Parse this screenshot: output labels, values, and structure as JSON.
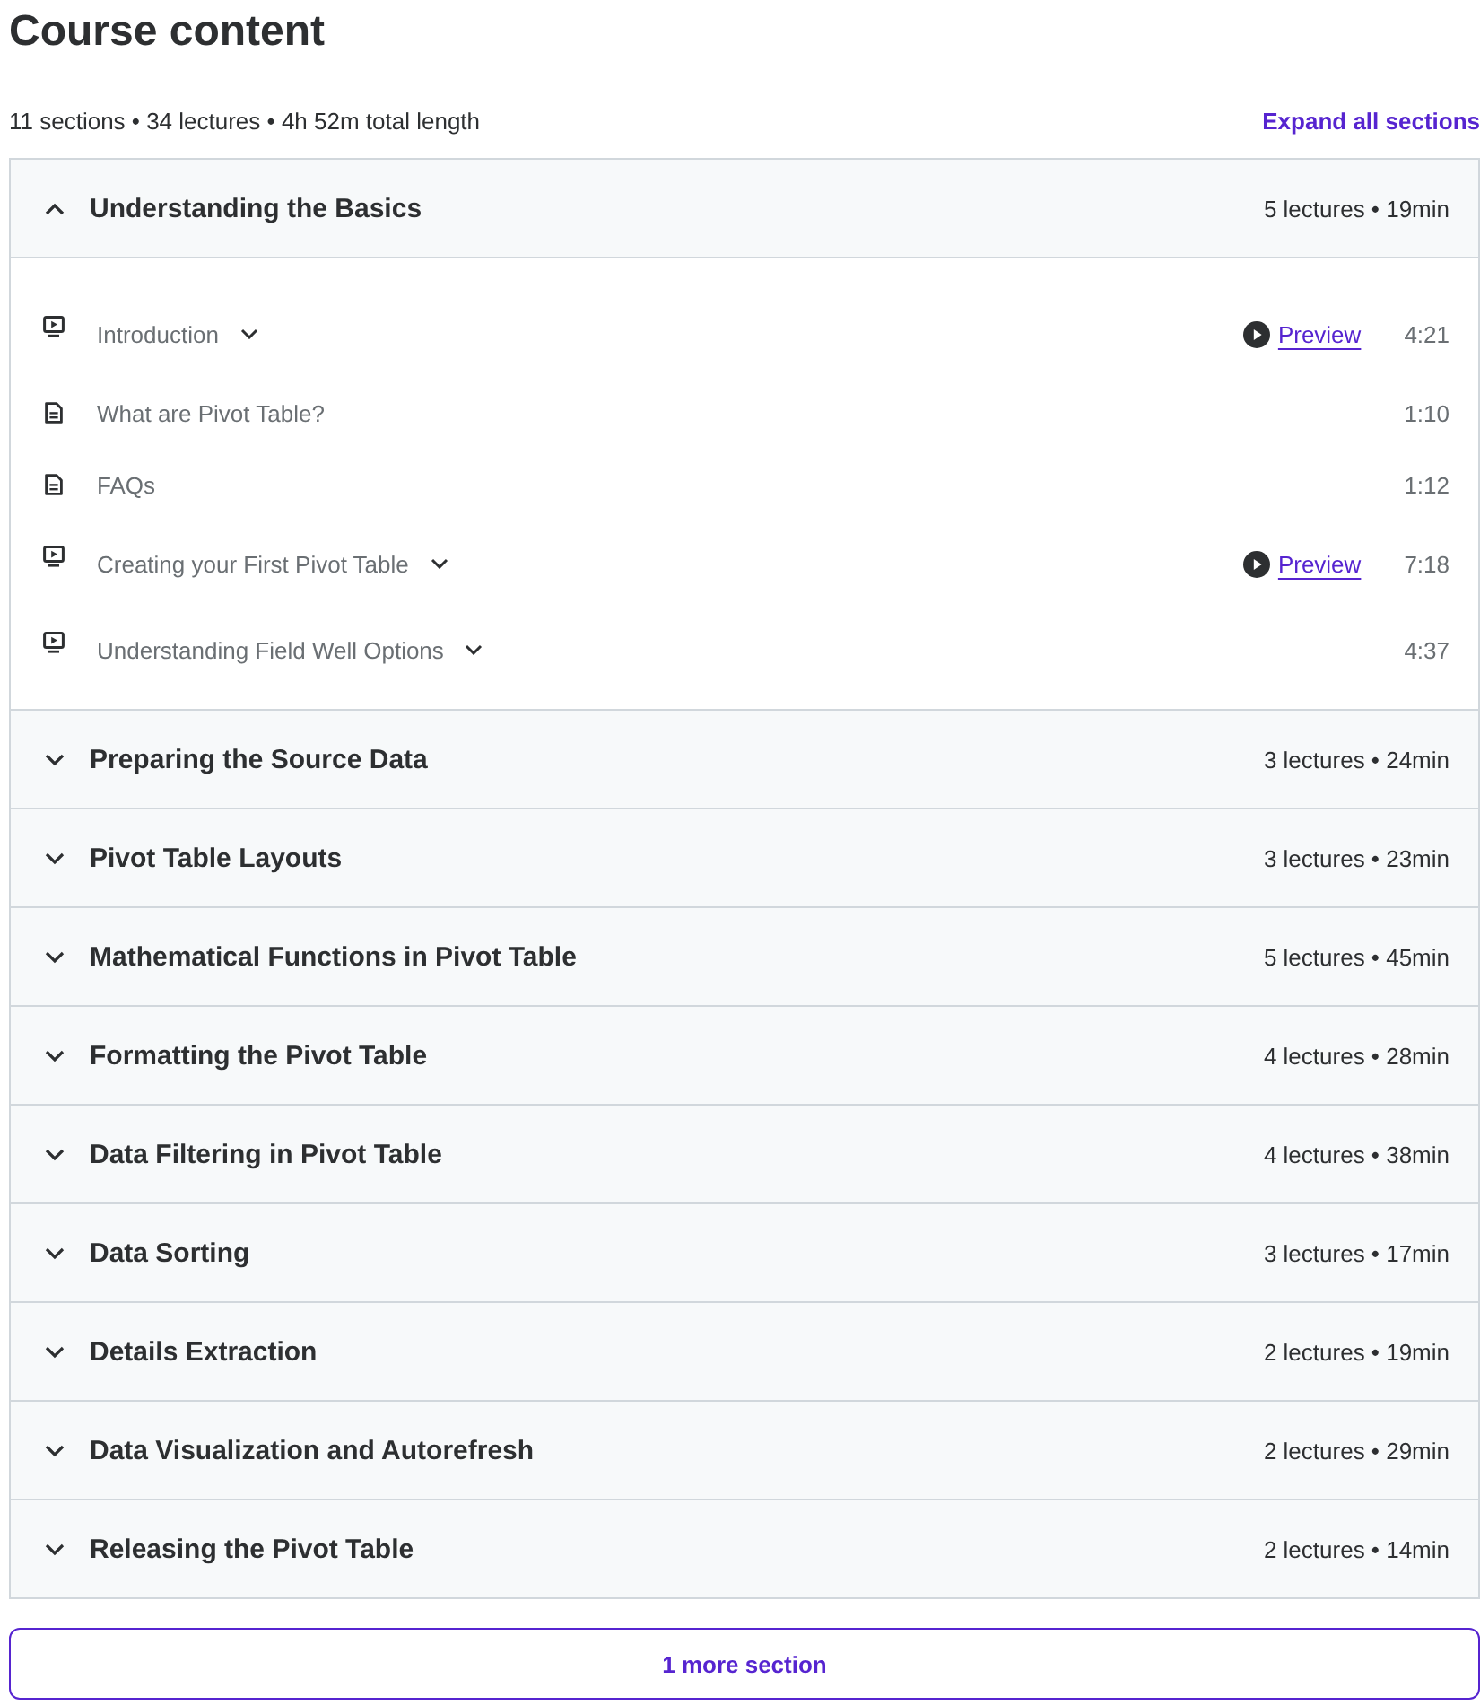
{
  "heading": "Course content",
  "summary": "11 sections • 34 lectures • 4h 52m total length",
  "expand_link": "Expand all sections",
  "sections": [
    {
      "title": "Understanding the Basics",
      "meta": "5 lectures • 19min",
      "expanded": true,
      "lectures": [
        {
          "kind": "video",
          "title": "Introduction",
          "expandable": true,
          "preview": "Preview",
          "duration": "4:21"
        },
        {
          "kind": "article",
          "title": "What are Pivot Table?",
          "expandable": false,
          "duration": "1:10"
        },
        {
          "kind": "article",
          "title": "FAQs",
          "expandable": false,
          "duration": "1:12"
        },
        {
          "kind": "video",
          "title": "Creating your First Pivot Table",
          "expandable": true,
          "preview": "Preview",
          "duration": "7:18"
        },
        {
          "kind": "video",
          "title": "Understanding Field Well Options",
          "expandable": true,
          "duration": "4:37"
        }
      ]
    },
    {
      "title": "Preparing the Source Data",
      "meta": "3 lectures • 24min",
      "expanded": false
    },
    {
      "title": "Pivot Table Layouts",
      "meta": "3 lectures • 23min",
      "expanded": false
    },
    {
      "title": "Mathematical Functions in Pivot Table",
      "meta": "5 lectures • 45min",
      "expanded": false
    },
    {
      "title": "Formatting the Pivot Table",
      "meta": "4 lectures • 28min",
      "expanded": false
    },
    {
      "title": "Data Filtering in Pivot Table",
      "meta": "4 lectures • 38min",
      "expanded": false
    },
    {
      "title": "Data Sorting",
      "meta": "3 lectures • 17min",
      "expanded": false
    },
    {
      "title": "Details Extraction",
      "meta": "2 lectures • 19min",
      "expanded": false
    },
    {
      "title": "Data Visualization and Autorefresh",
      "meta": "2 lectures • 29min",
      "expanded": false
    },
    {
      "title": "Releasing the Pivot Table",
      "meta": "2 lectures • 14min",
      "expanded": false
    }
  ],
  "more_button": "1 more section"
}
